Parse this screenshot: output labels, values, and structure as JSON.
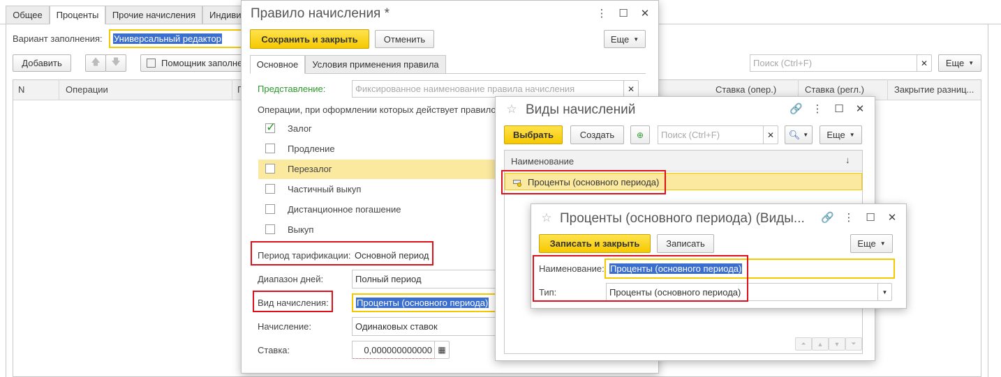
{
  "bg": {
    "tabs": [
      "Общее",
      "Проценты",
      "Прочие начисления",
      "Индиви"
    ],
    "fill_variant_label": "Вариант заполнения:",
    "fill_variant_value": "Универсальный редактор",
    "add_button": "Добавить",
    "assistant_button": "Помощник заполне",
    "search_placeholder": "Поиск (Ctrl+F)",
    "more_button": "Еще",
    "columns": [
      "N",
      "Операции",
      "Г",
      "Ставка (опер.)",
      "Ставка (регл.)",
      "Закрытие разниц..."
    ]
  },
  "rule": {
    "title": "Правило начисления *",
    "save_close": "Сохранить и закрыть",
    "cancel": "Отменить",
    "more": "Еще",
    "tabs": [
      "Основное",
      "Условия применения правила"
    ],
    "repr_label": "Представление:",
    "repr_placeholder": "Фиксированное наименование правила начисления",
    "ops_label": "Операции, при оформлении которых действует правило:",
    "ops": [
      {
        "label": "Залог",
        "checked": true
      },
      {
        "label": "Продление",
        "checked": false
      },
      {
        "label": "Перезалог",
        "checked": false
      },
      {
        "label": "Частичный выкуп",
        "checked": false
      },
      {
        "label": "Дистанционное погашение",
        "checked": false
      },
      {
        "label": "Выкуп",
        "checked": false
      }
    ],
    "period_label": "Период тарификации:",
    "period_value": "Основной период",
    "range_label": "Диапазон дней:",
    "range_value": "Полный период",
    "kind_label": "Вид начисления:",
    "kind_value": "Проценты (основного периода)",
    "accrual_label": "Начисление:",
    "accrual_value": "Одинаковых ставок",
    "rate_label": "Ставка:",
    "rate_value": "0,000000000000"
  },
  "kinds": {
    "title": "Виды начислений",
    "select": "Выбрать",
    "create": "Создать",
    "search_placeholder": "Поиск (Ctrl+F)",
    "more": "Еще",
    "col_name": "Наименование",
    "sort_icon": "↓",
    "row": "Проценты (основного периода)"
  },
  "item": {
    "title": "Проценты (основного периода) (Виды...",
    "save_close": "Записать и закрыть",
    "save": "Записать",
    "more": "Еще",
    "name_label": "Наименование:",
    "name_value": "Проценты (основного периода)",
    "type_label": "Тип:",
    "type_value": "Проценты (основного периода)"
  },
  "colors": {
    "accent": "#f5c800",
    "highlight": "#fbe9a0",
    "selection": "#3a6fd0",
    "callout": "#e0101a",
    "green_label": "#2b9a2b"
  }
}
